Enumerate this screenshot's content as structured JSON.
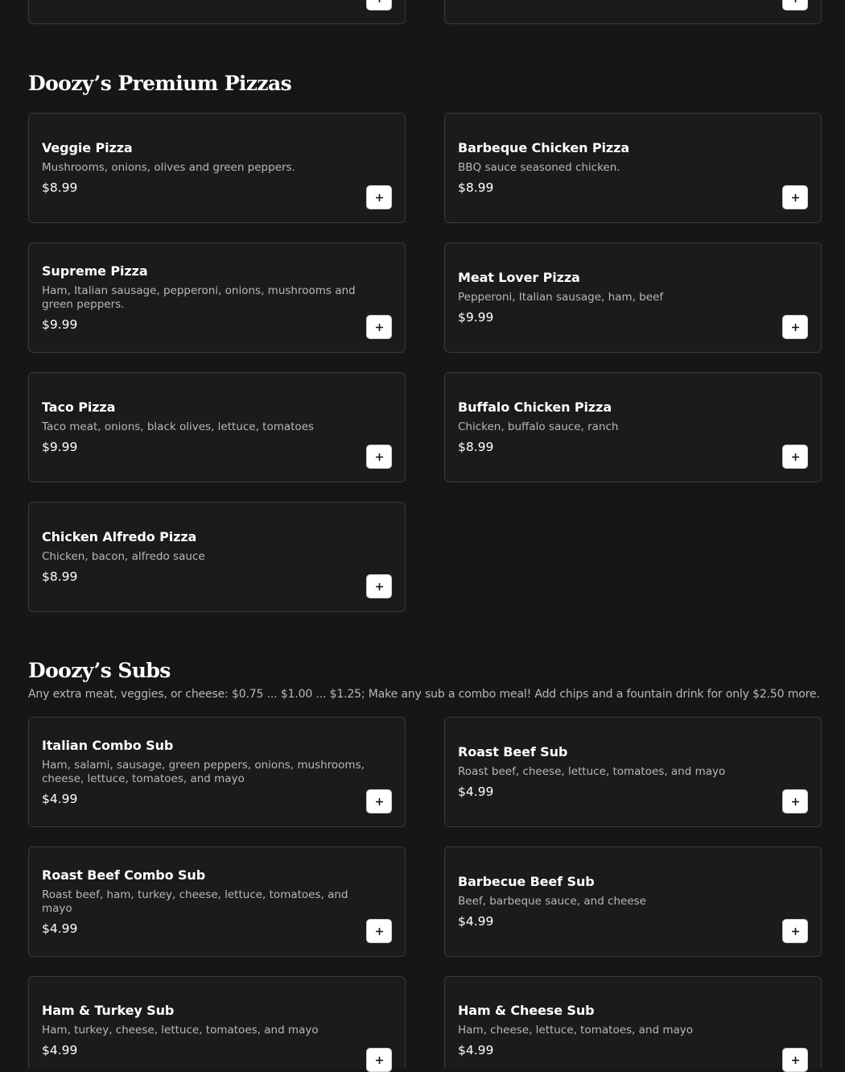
{
  "colors": {
    "background": "#161616",
    "card": "#1b1b1b",
    "border": "#3a3a3a",
    "button": "#ffffff"
  },
  "add_icon": "plus-icon",
  "sections": [
    {
      "title": "Doozy’s Premium Pizzas",
      "items": [
        {
          "name": "Veggie Pizza",
          "desc": "Mushrooms, onions, olives and green peppers.",
          "price": "$8.99"
        },
        {
          "name": "Barbeque Chicken Pizza",
          "desc": "BBQ sauce seasoned chicken.",
          "price": "$8.99"
        },
        {
          "name": "Supreme Pizza",
          "desc": "Ham, Italian sausage, pepperoni, onions, mushrooms and green peppers.",
          "price": "$9.99"
        },
        {
          "name": "Meat Lover Pizza",
          "desc": "Pepperoni, Italian sausage, ham, beef",
          "price": "$9.99"
        },
        {
          "name": "Taco Pizza",
          "desc": "Taco meat, onions, black olives, lettuce, tomatoes",
          "price": "$9.99"
        },
        {
          "name": "Buffalo Chicken Pizza",
          "desc": "Chicken, buffalo sauce, ranch",
          "price": "$8.99"
        },
        {
          "name": "Chicken Alfredo Pizza",
          "desc": "Chicken, bacon, alfredo sauce",
          "price": "$8.99"
        }
      ]
    },
    {
      "title": "Doozy’s Subs",
      "note": "Any extra meat, veggies, or cheese: $0.75 ... $1.00 ... $1.25; Make any sub a combo meal! Add chips and a fountain drink for only $2.50 more.",
      "items": [
        {
          "name": "Italian Combo Sub",
          "desc": "Ham, salami, sausage, green peppers, onions, mushrooms, cheese, lettuce, tomatoes, and mayo",
          "price": "$4.99"
        },
        {
          "name": "Roast Beef Sub",
          "desc": "Roast beef, cheese, lettuce, tomatoes, and mayo",
          "price": "$4.99"
        },
        {
          "name": "Roast Beef Combo Sub",
          "desc": "Roast beef, ham, turkey, cheese, lettuce, tomatoes, and mayo",
          "price": "$4.99"
        },
        {
          "name": "Barbecue Beef Sub",
          "desc": "Beef, barbeque sauce, and cheese",
          "price": "$4.99"
        },
        {
          "name": "Ham & Turkey Sub",
          "desc": "Ham, turkey, cheese, lettuce, tomatoes, and mayo",
          "price": "$4.99"
        },
        {
          "name": "Ham & Cheese Sub",
          "desc": "Ham, cheese, lettuce, tomatoes, and mayo",
          "price": "$4.99"
        }
      ]
    }
  ]
}
